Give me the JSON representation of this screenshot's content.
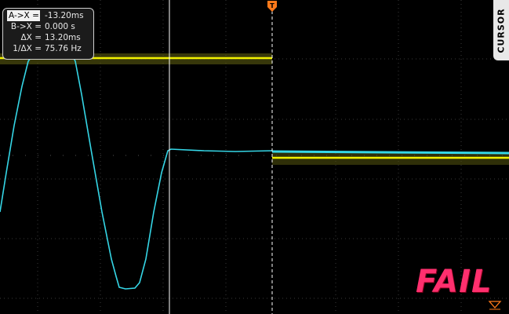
{
  "readout": {
    "rows": [
      {
        "label": "A->X =",
        "value": "-13.20ms"
      },
      {
        "label": "B->X =",
        "value": "0.000 s"
      },
      {
        "label": "ΔX =",
        "value": "13.20ms"
      },
      {
        "label": "1/ΔX =",
        "value": "75.76 Hz"
      }
    ]
  },
  "side_tab": {
    "label": "CURSOR"
  },
  "verdict": {
    "label": "FAIL",
    "color": "#ff2f6e"
  },
  "icons": {
    "trigger_marker": "trigger-position-icon",
    "bottom_marker": "time-reference-icon"
  },
  "colors": {
    "channel1": "#f2f200",
    "channel2": "#35d6e6",
    "grid": "#3a3a3a"
  }
}
